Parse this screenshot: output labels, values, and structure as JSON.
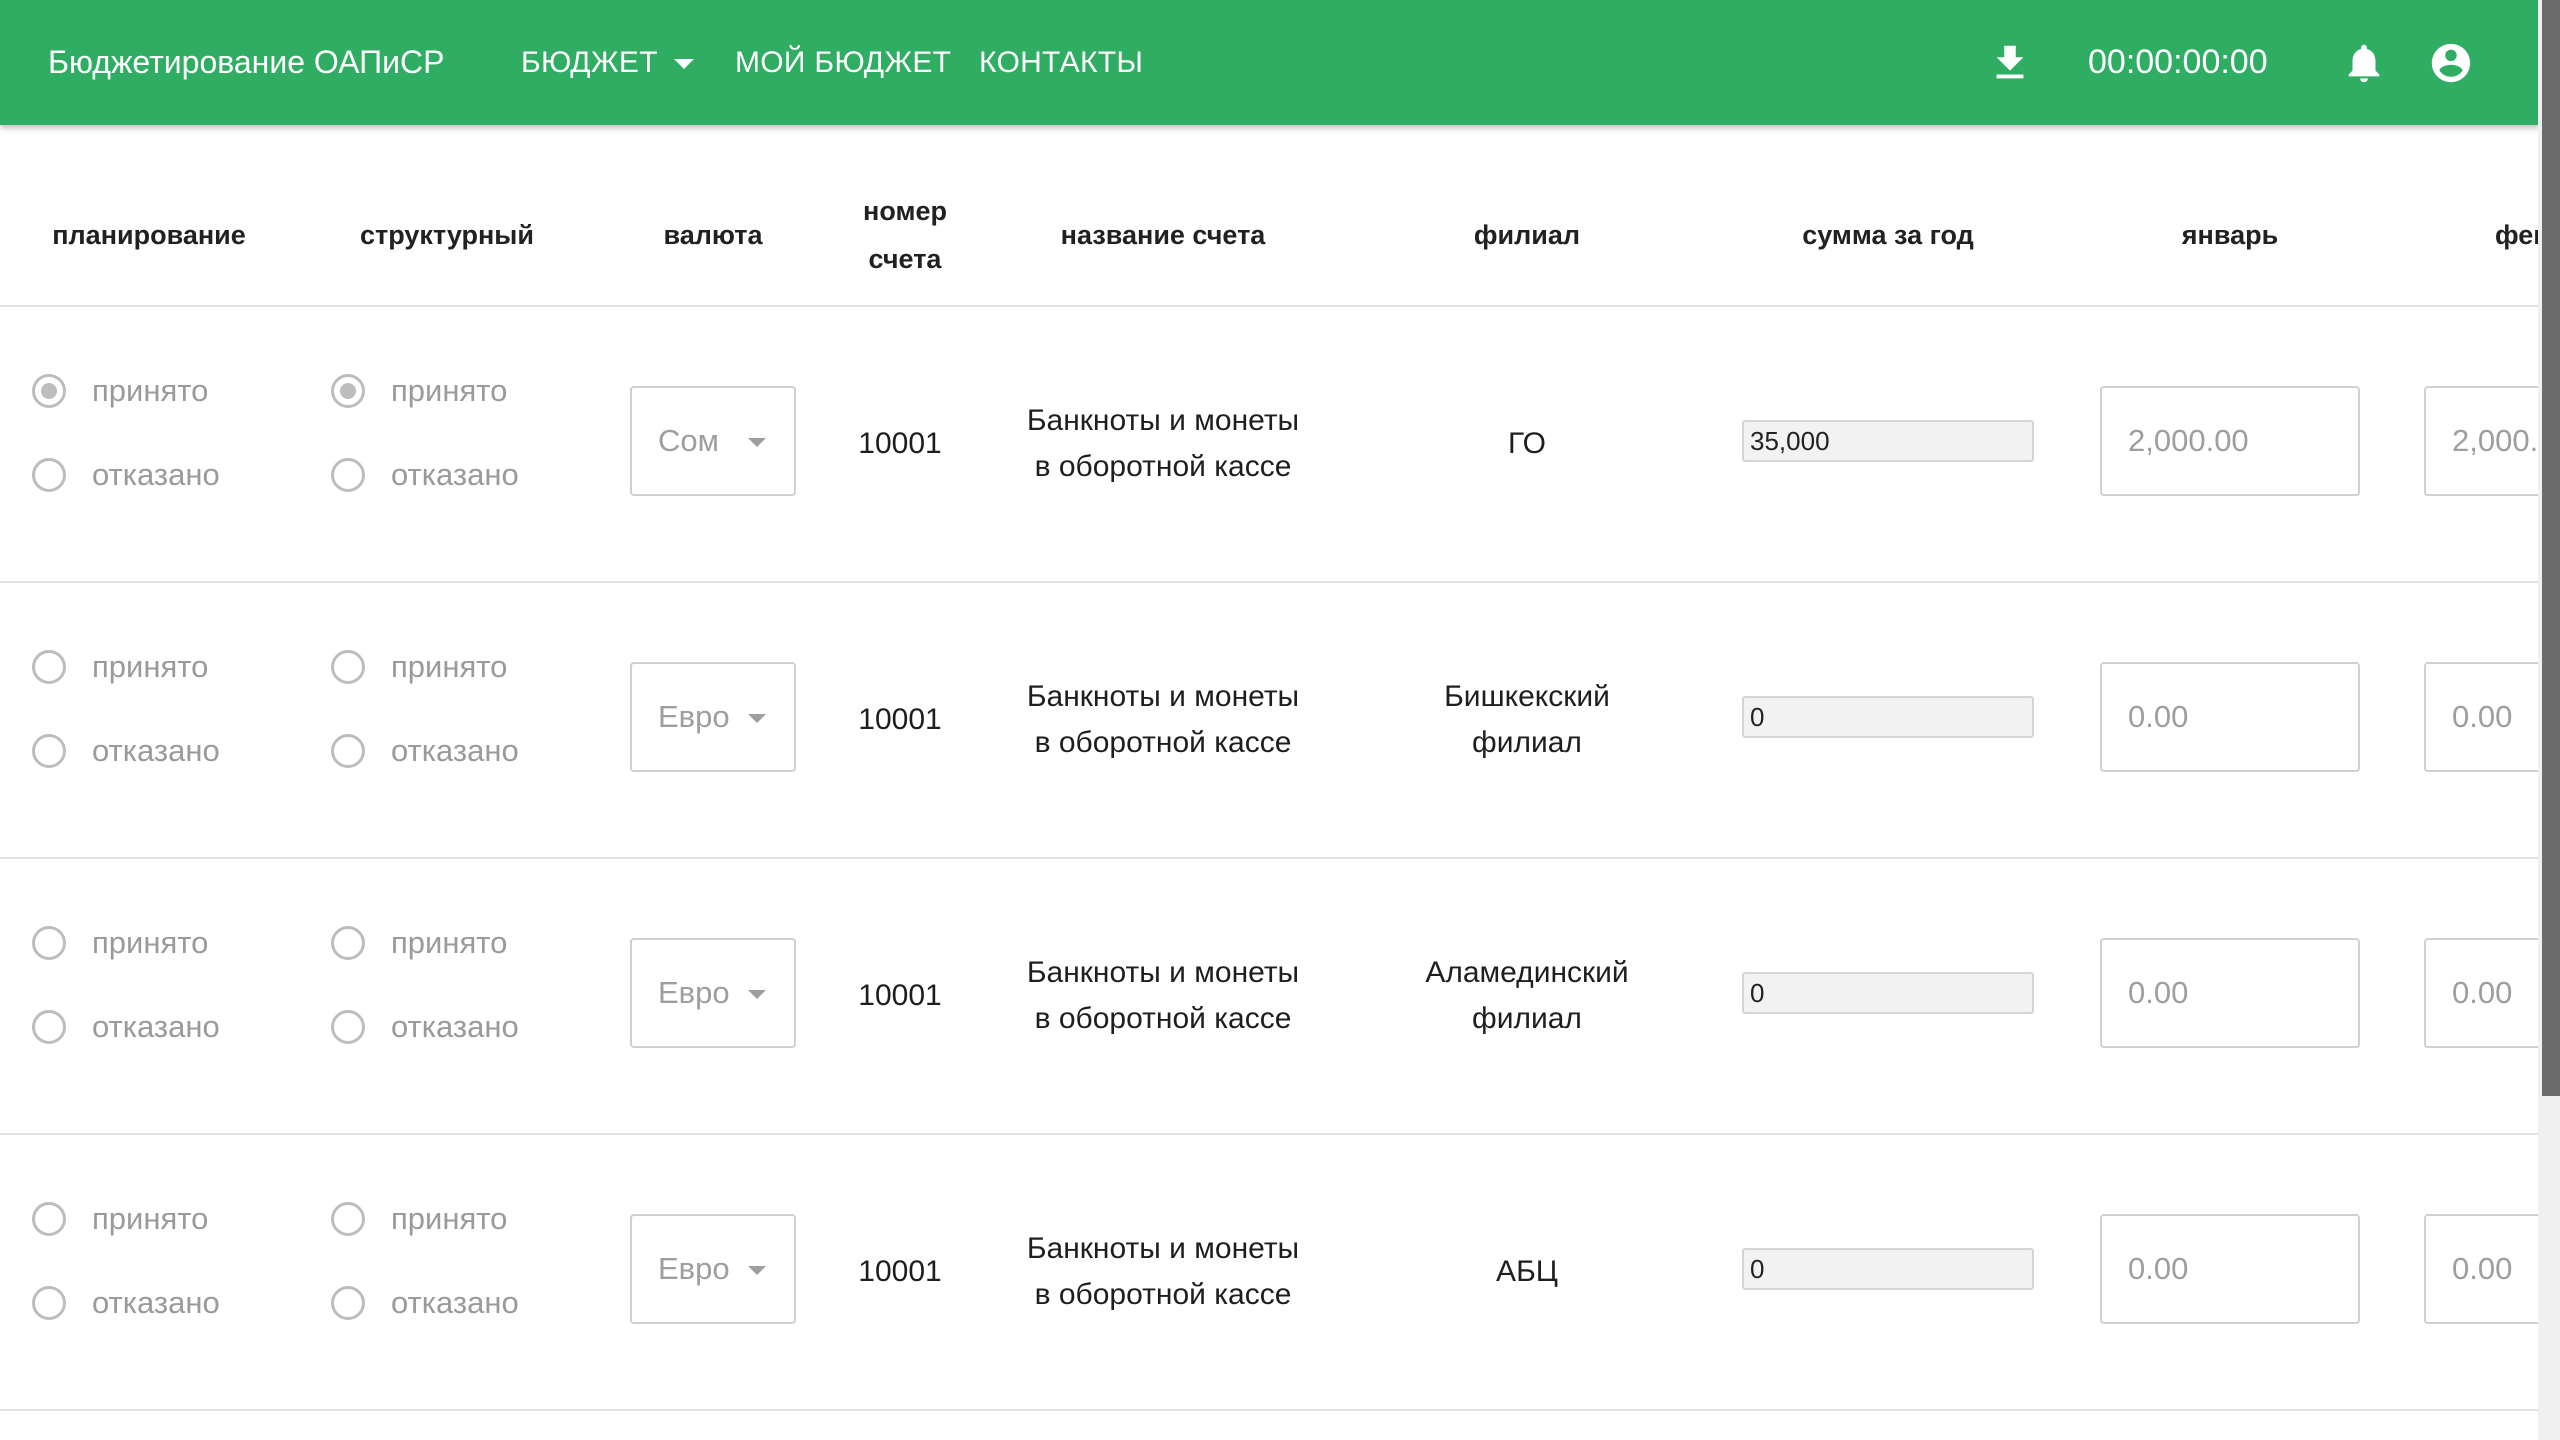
{
  "app": {
    "title": "Бюджетирование ОАПиСР",
    "nav": [
      {
        "label": "БЮДЖЕТ",
        "dropdown": true
      },
      {
        "label": "МОЙ БЮДЖЕТ"
      },
      {
        "label": "КОНТАКТЫ"
      }
    ],
    "timer": "00:00:00:00",
    "icons": [
      "download-icon",
      "bell-icon",
      "account-circle-icon"
    ],
    "accent_color": "#2fad63"
  },
  "table": {
    "headers": {
      "planning": "планирование",
      "structural": "структурный",
      "currency": "валюта",
      "account_number_line1": "номер",
      "account_number_line2": "счета",
      "account_name": "название счета",
      "branch": "филиал",
      "year_sum": "сумма за год",
      "january": "январь",
      "february_partial": "фев"
    },
    "radio_labels": {
      "accepted": "принято",
      "rejected": "отказано"
    },
    "rows": [
      {
        "planning": "принято",
        "structural": "принято",
        "currency": "Сом",
        "account_number": "10001",
        "account_name_line1": "Банкноты и монеты",
        "account_name_line2": "в оборотной кассе",
        "branch_line1": "ГО",
        "branch_line2": "",
        "year_sum": "35,000",
        "january": "2,000.00",
        "february": "2,000."
      },
      {
        "planning": "",
        "structural": "",
        "currency": "Евро",
        "account_number": "10001",
        "account_name_line1": "Банкноты и монеты",
        "account_name_line2": "в оборотной кассе",
        "branch_line1": "Бишкекский",
        "branch_line2": "филиал",
        "year_sum": "0",
        "january": "0.00",
        "february": "0.00"
      },
      {
        "planning": "",
        "structural": "",
        "currency": "Евро",
        "account_number": "10001",
        "account_name_line1": "Банкноты и монеты",
        "account_name_line2": "в оборотной кассе",
        "branch_line1": "Аламединский",
        "branch_line2": "филиал",
        "year_sum": "0",
        "january": "0.00",
        "february": "0.00"
      },
      {
        "planning": "",
        "structural": "",
        "currency": "Евро",
        "account_number": "10001",
        "account_name_line1": "Банкноты и монеты",
        "account_name_line2": "в оборотной кассе",
        "branch_line1": "АБЦ",
        "branch_line2": "",
        "year_sum": "0",
        "january": "0.00",
        "february": "0.00"
      }
    ]
  }
}
